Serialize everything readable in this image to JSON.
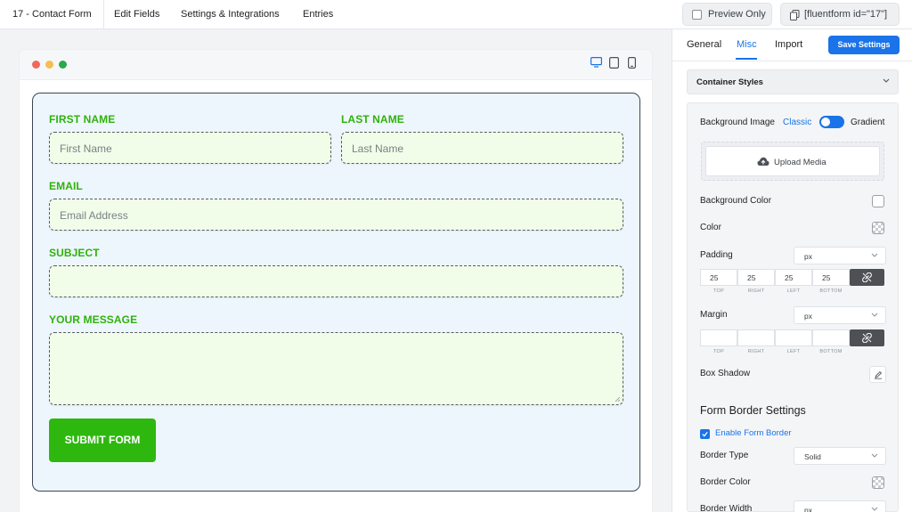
{
  "topbar": {
    "form_title": "17 - Contact Form",
    "nav": [
      "Edit Fields",
      "Settings & Integrations",
      "Entries"
    ],
    "preview_label": "Preview Only",
    "shortcode": "[fluentform id=\"17\"]"
  },
  "window": {
    "dot_colors": [
      "#ee6a5f",
      "#f5be4f",
      "#2ca84c"
    ],
    "device_icons": [
      "desktop-icon",
      "tablet-icon",
      "mobile-icon"
    ]
  },
  "form": {
    "label_color": "#2fb20c",
    "first_name_label": "FIRST NAME",
    "first_name_placeholder": "First Name",
    "last_name_label": "LAST NAME",
    "last_name_placeholder": "Last Name",
    "email_label": "EMAIL",
    "email_placeholder": "Email Address",
    "subject_label": "SUBJECT",
    "message_label": "YOUR MESSAGE",
    "submit_label": "SUBMIT FORM",
    "submit_color": "#2eb80f"
  },
  "panel": {
    "tabs": [
      "General",
      "Misc",
      "Import"
    ],
    "active_tab": "Misc",
    "save_label": "Save Settings",
    "accent": "#1a73e8",
    "container_styles_label": "Container Styles",
    "background_image_label": "Background Image",
    "classic_label": "Classic",
    "gradient_label": "Gradient",
    "upload_label": "Upload Media",
    "background_color_label": "Background Color",
    "color_label": "Color",
    "padding_label": "Padding",
    "padding_unit": "px",
    "padding_values": [
      "25",
      "25",
      "25",
      "25"
    ],
    "side_labels": [
      "TOP",
      "RIGHT",
      "LEFT",
      "BOTTOM"
    ],
    "margin_label": "Margin",
    "margin_unit": "px",
    "box_shadow_label": "Box Shadow",
    "form_border_title": "Form Border Settings",
    "enable_border_label": "Enable Form Border",
    "border_type_label": "Border Type",
    "border_type_value": "Solid",
    "border_color_label": "Border Color",
    "border_width_label": "Border Width",
    "border_width_unit": "px"
  }
}
